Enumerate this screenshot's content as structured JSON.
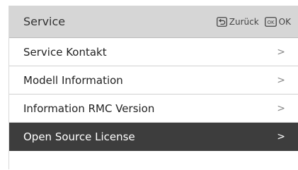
{
  "header": {
    "title": "Service",
    "back_label": "Zurück",
    "ok_label": "OK",
    "ok_icon_text": "OK"
  },
  "menu": {
    "items": [
      {
        "label": "Service Kontakt",
        "selected": false
      },
      {
        "label": "Modell Information",
        "selected": false
      },
      {
        "label": "Information RMC Version",
        "selected": false
      },
      {
        "label": "Open Source License",
        "selected": true
      }
    ],
    "chevron": ">"
  },
  "colors": {
    "header_bg": "#d6d6d6",
    "selected_bg": "#3d3d3d",
    "item_bg": "#ffffff"
  },
  "icons": [
    "back-icon",
    "ok-icon",
    "chevron-right-icon"
  ]
}
